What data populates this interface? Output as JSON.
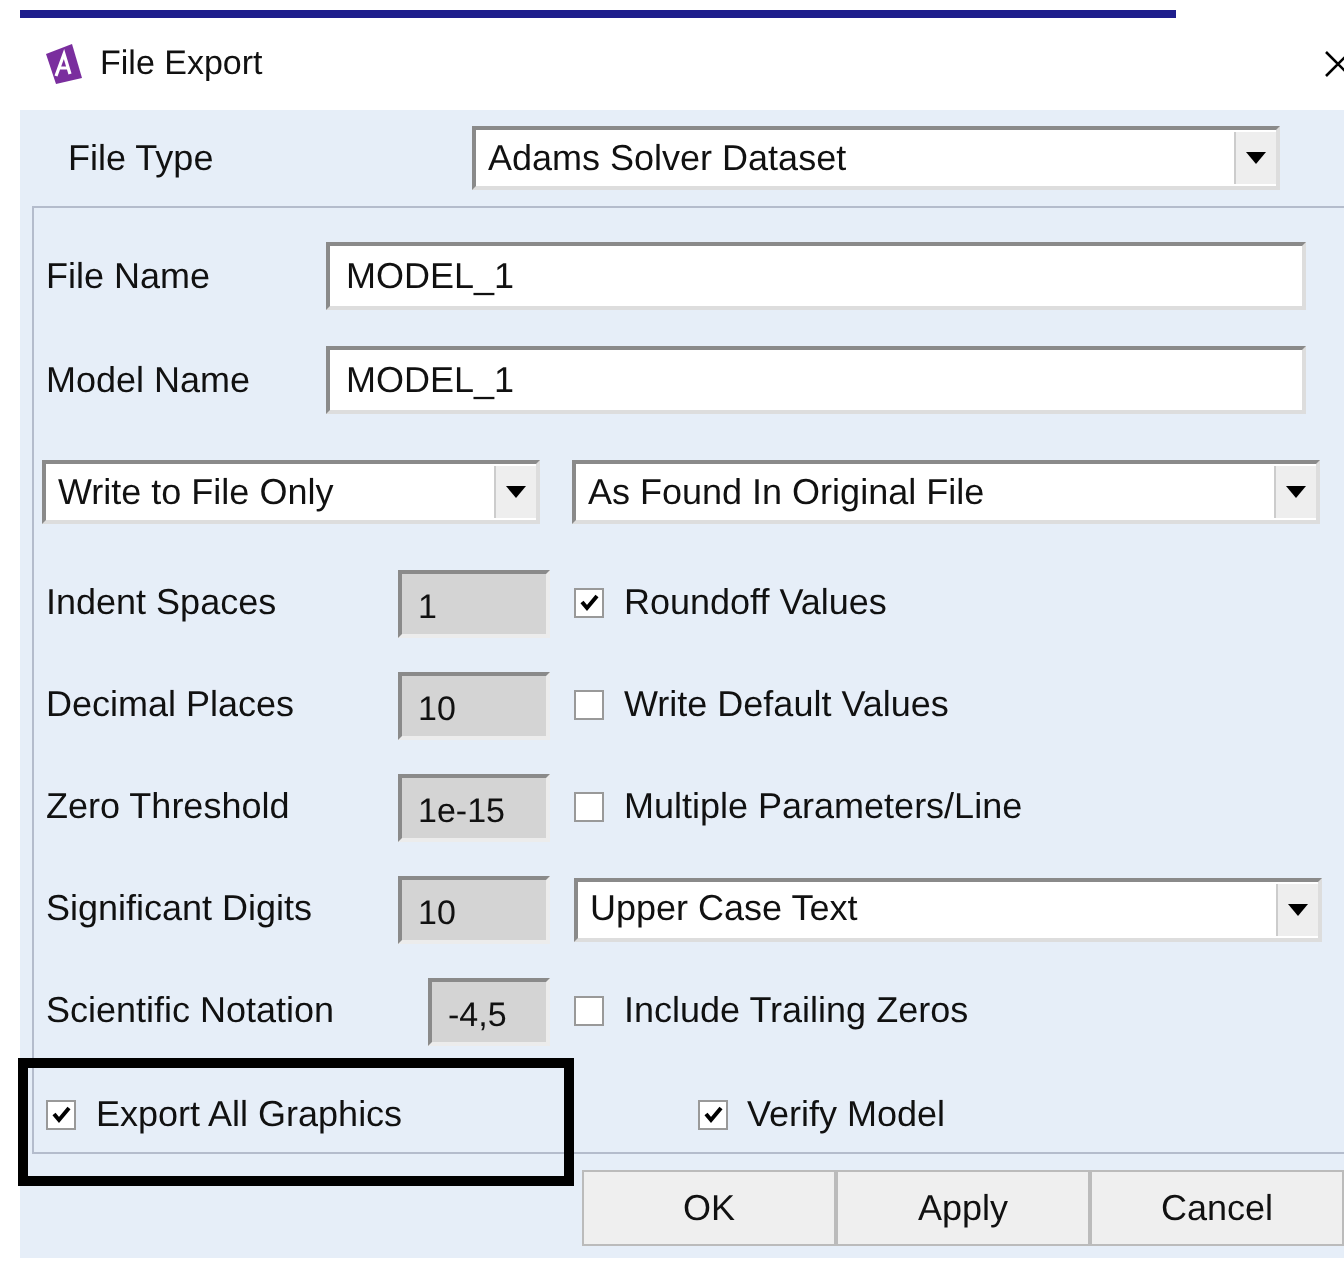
{
  "window": {
    "title": "File Export"
  },
  "file_type": {
    "label": "File Type",
    "value": "Adams Solver Dataset"
  },
  "name_fields": [
    {
      "label": "File Name",
      "value": "MODEL_1"
    },
    {
      "label": "Model Name",
      "value": "MODEL_1"
    }
  ],
  "mode_dropdowns": [
    {
      "value": "Write to File Only"
    },
    {
      "value": "As Found In Original File"
    }
  ],
  "settings": [
    {
      "label": "Indent Spaces",
      "value": "1",
      "option": {
        "kind": "checkbox",
        "label": "Roundoff Values",
        "checked": true
      }
    },
    {
      "label": "Decimal Places",
      "value": "10",
      "option": {
        "kind": "checkbox",
        "label": "Write Default Values",
        "checked": false
      }
    },
    {
      "label": "Zero Threshold",
      "value": "1e-15",
      "option": {
        "kind": "checkbox",
        "label": "Multiple Parameters/Line",
        "checked": false
      }
    },
    {
      "label": "Significant Digits",
      "value": "10",
      "option": {
        "kind": "dropdown",
        "value": "Upper Case Text"
      }
    },
    {
      "label": "Scientific Notation",
      "value": "-4,5",
      "option": {
        "kind": "checkbox",
        "label": "Include Trailing Zeros",
        "checked": false
      }
    }
  ],
  "bottom_options": [
    {
      "label": "Export All Graphics",
      "checked": true,
      "highlighted": true
    },
    {
      "label": "Verify Model",
      "checked": true,
      "highlighted": false
    }
  ],
  "buttons": [
    "OK",
    "Apply",
    "Cancel"
  ]
}
